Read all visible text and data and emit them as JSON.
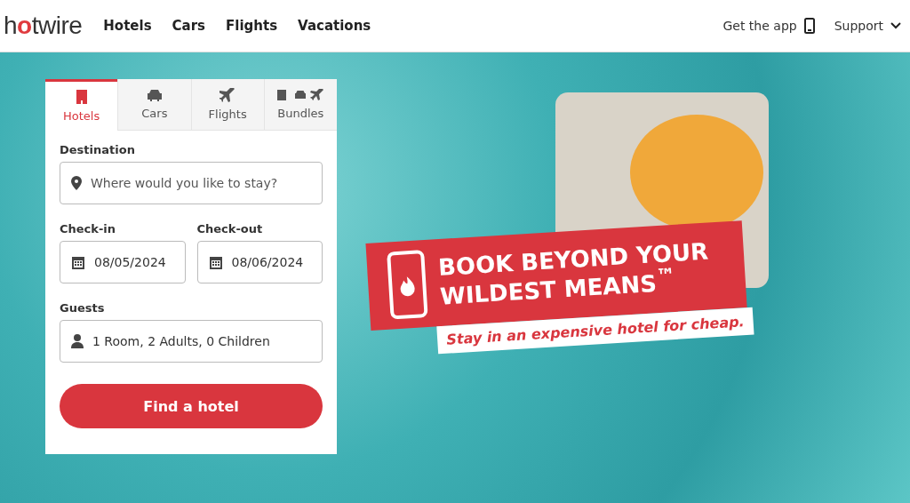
{
  "header": {
    "logo": "hotwire",
    "nav": [
      "Hotels",
      "Cars",
      "Flights",
      "Vacations"
    ],
    "get_app": "Get the app",
    "support": "Support"
  },
  "search_card": {
    "tabs": [
      {
        "label": "Hotels",
        "kind": "hotel",
        "selected": true
      },
      {
        "label": "Cars",
        "kind": "car",
        "selected": false
      },
      {
        "label": "Flights",
        "kind": "flight",
        "selected": false
      },
      {
        "label": "Bundles",
        "kind": "bundle",
        "selected": false
      }
    ],
    "destination": {
      "label": "Destination",
      "placeholder": "Where would you like to stay?"
    },
    "check_in": {
      "label": "Check-in",
      "value": "08/05/2024"
    },
    "check_out": {
      "label": "Check-out",
      "value": "08/06/2024"
    },
    "guests": {
      "label": "Guests",
      "value": "1 Room, 2 Adults, 0 Children"
    },
    "button": "Find a hotel"
  },
  "promo": {
    "headline": "BOOK BEYOND YOUR WILDEST MEANS$^{™}$",
    "tagline": "Stay in an expensive hotel for cheap."
  }
}
